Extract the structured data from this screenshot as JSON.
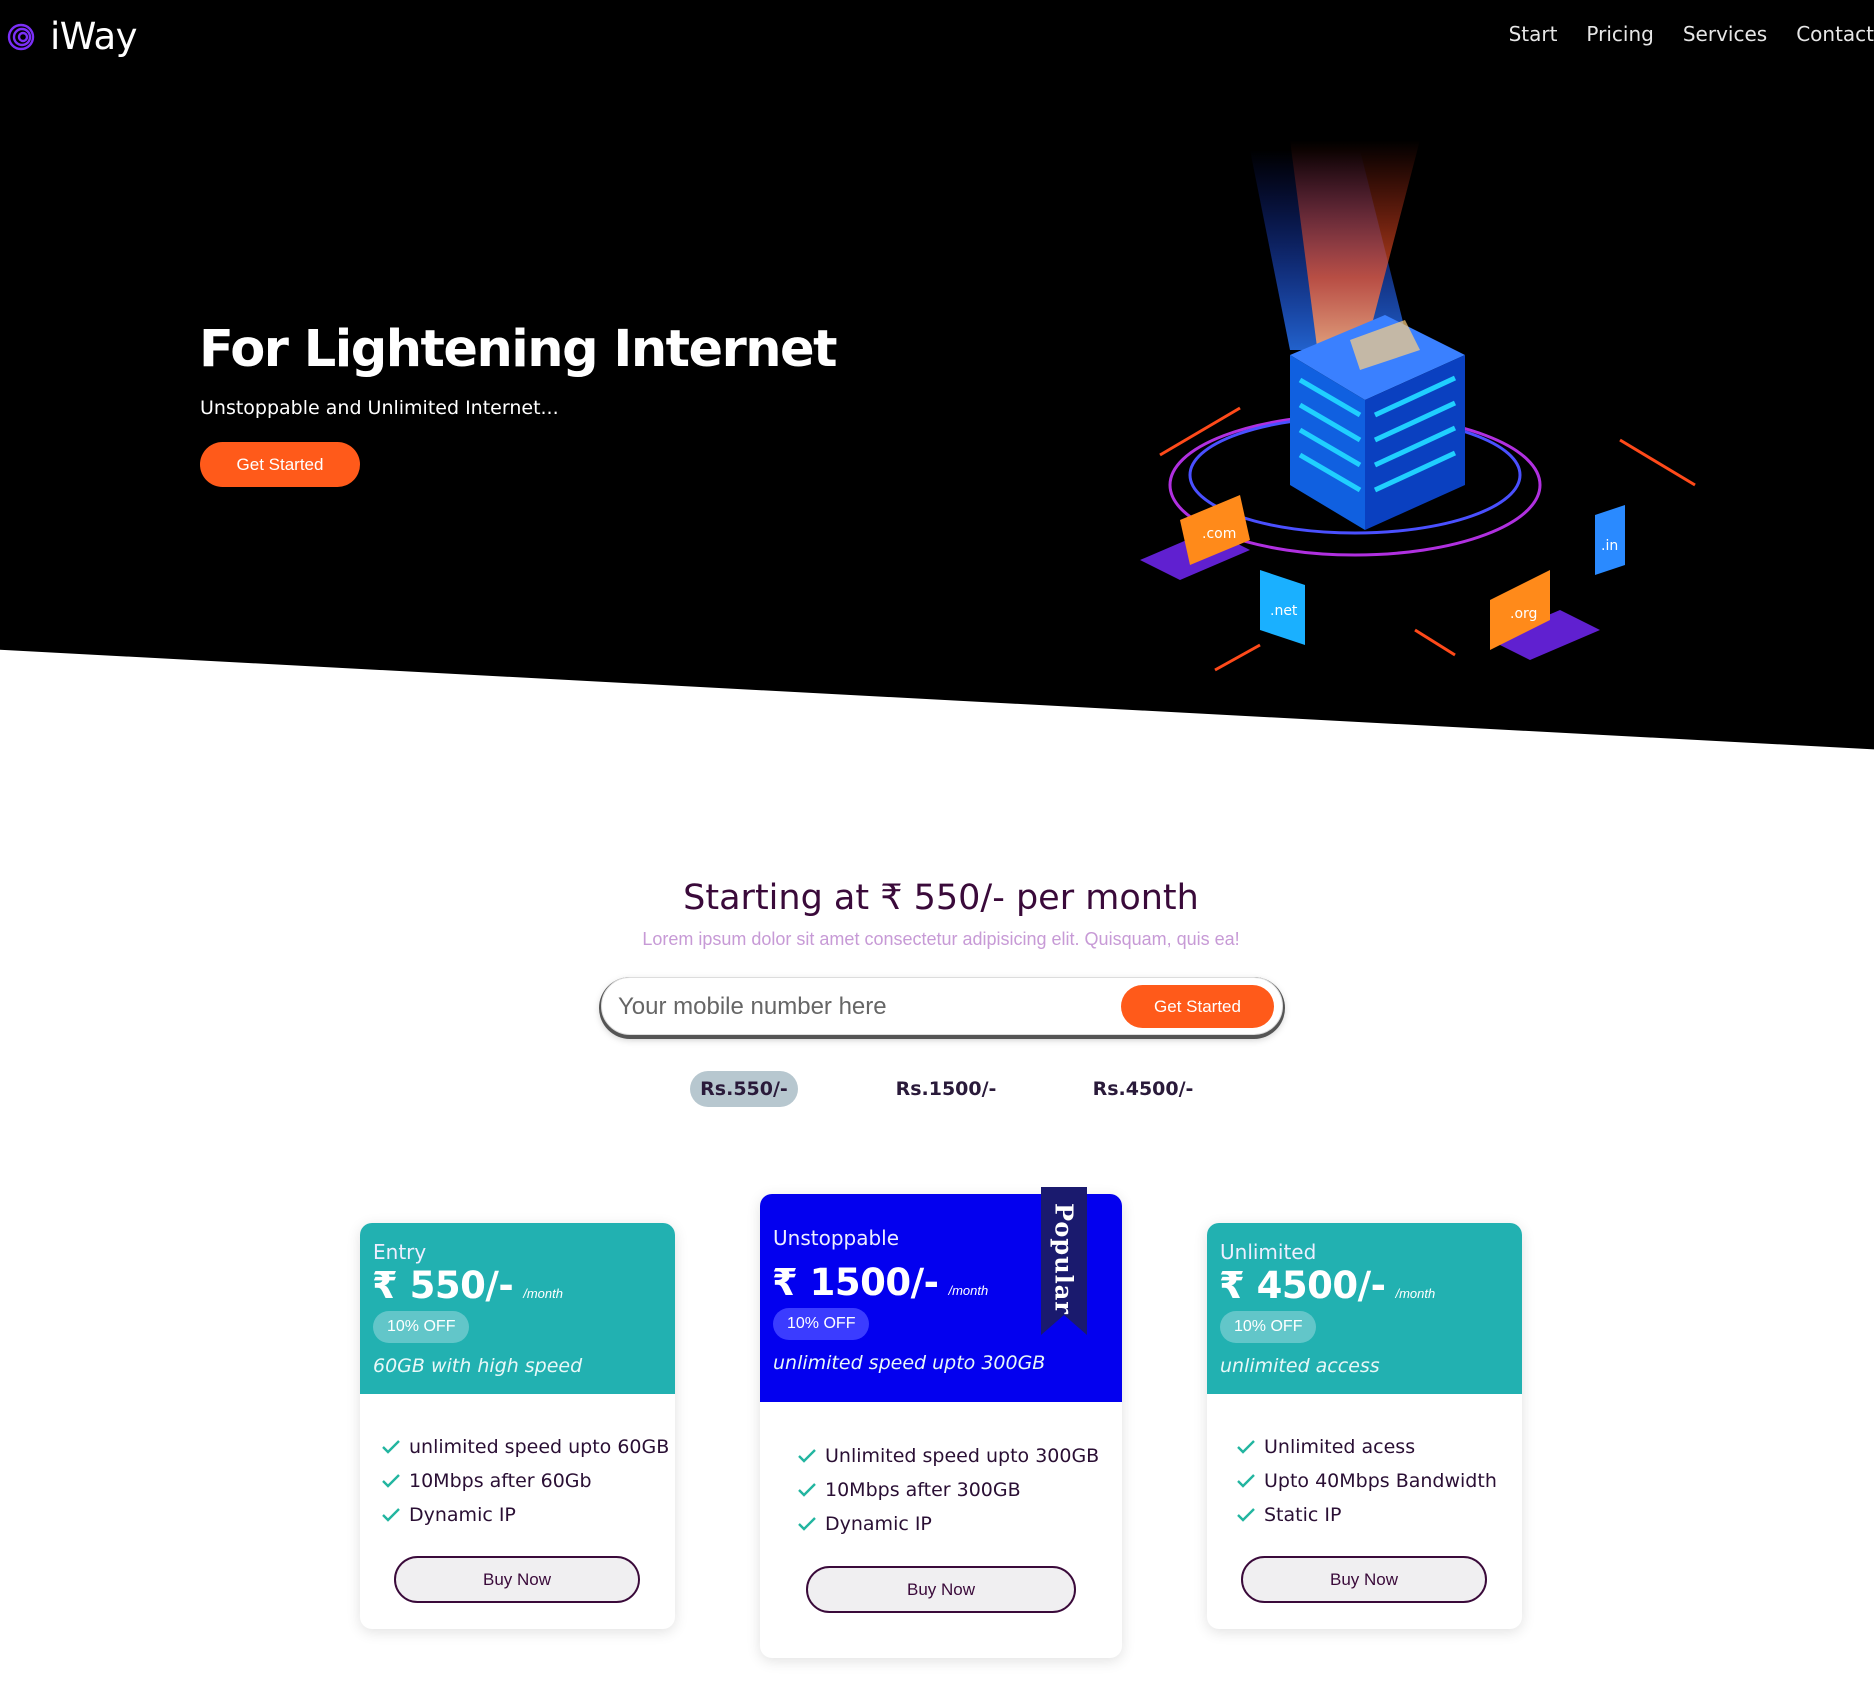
{
  "brand": {
    "name": "iWay",
    "accent": "#7b2ff7"
  },
  "nav": {
    "items": [
      "Start",
      "Pricing",
      "Services",
      "Contact"
    ]
  },
  "hero": {
    "title": "For Lightening Internet",
    "subtitle": "Unstoppable and Unlimited Internet...",
    "button": "Get Started",
    "illustration_labels": [
      ".com",
      ".net",
      ".org",
      ".in"
    ]
  },
  "intro": {
    "title": "Starting at ₹ 550/- per month",
    "subtitle": "Lorem ipsum dolor sit amet consectetur adipisicing elit. Quisquam, quis ea!"
  },
  "signup": {
    "placeholder": "Your mobile number here",
    "button": "Get Started"
  },
  "price_tabs": [
    "Rs.550/-",
    "Rs.1500/-",
    "Rs.4500/-"
  ],
  "active_tab": 0,
  "plans": [
    {
      "name": "Entry",
      "price": "₹ 550/-",
      "per": "/month",
      "badge": "10% OFF",
      "tagline": "60GB with high speed",
      "features": [
        "unlimited speed upto 60GB",
        "10Mbps after 60Gb",
        "Dynamic IP"
      ],
      "button": "Buy Now",
      "color": "#22b1b1"
    },
    {
      "name": "Unstoppable",
      "price": "₹ 1500/-",
      "per": "/month",
      "badge": "10% OFF",
      "tagline": "unlimited speed upto 300GB",
      "features": [
        "Unlimited speed upto 300GB",
        "10Mbps after 300GB",
        "Dynamic IP"
      ],
      "button": "Buy Now",
      "color": "#0300ef",
      "ribbon": "Popular"
    },
    {
      "name": "Unlimited",
      "price": "₹ 4500/-",
      "per": "/month",
      "badge": "10% OFF",
      "tagline": "unlimited access",
      "features": [
        "Unlimited acess",
        "Upto 40Mbps Bandwidth",
        "Static IP"
      ],
      "button": "Buy Now",
      "color": "#22b1b1"
    }
  ],
  "colors": {
    "cta": "#ff5a1a",
    "check": "#22b5a0",
    "heading": "#3a0a3a"
  }
}
